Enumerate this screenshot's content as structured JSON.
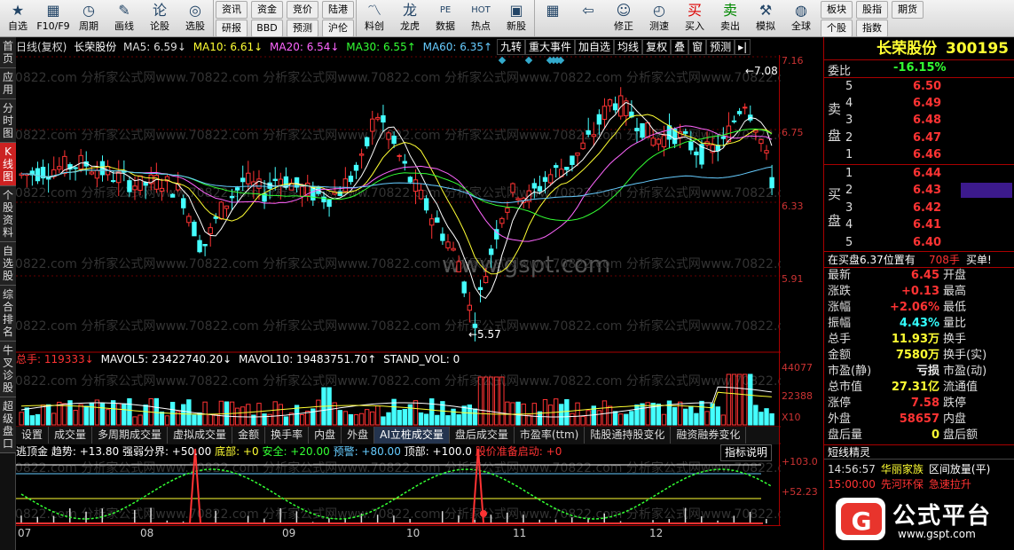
{
  "toolbar": {
    "items": [
      {
        "label": "自选",
        "icon": "star-icon"
      },
      {
        "label": "F10/F9",
        "icon": "f10-icon"
      },
      {
        "label": "周期",
        "icon": "clock-icon"
      },
      {
        "label": "画线",
        "icon": "pen-icon"
      },
      {
        "label": "论股",
        "icon": "chat-icon"
      },
      {
        "label": "选股",
        "icon": "stock-select-icon"
      }
    ],
    "pairs": [
      [
        "资讯",
        "研报"
      ],
      [
        "资金",
        "BBD"
      ],
      [
        "竞价",
        "预测"
      ],
      [
        "陆港",
        "沪伦"
      ]
    ],
    "items2": [
      {
        "label": "料创",
        "icon": "chart-icon"
      },
      {
        "label": "龙虎",
        "icon": "dragon-icon"
      },
      {
        "label": "数据",
        "icon": "data-icon"
      },
      {
        "label": "热点",
        "icon": "hot-icon"
      },
      {
        "label": "新股",
        "icon": "newstock-icon"
      }
    ],
    "items3": [
      {
        "label": "",
        "icon": "grid-icon"
      },
      {
        "label": "",
        "icon": "back-arrow-icon"
      },
      {
        "label": "修正",
        "icon": "fix-icon"
      },
      {
        "label": "测速",
        "icon": "speed-icon"
      },
      {
        "label": "买入",
        "icon": "buy-icon",
        "glyph": "买"
      },
      {
        "label": "卖出",
        "icon": "sell-icon",
        "glyph": "卖"
      },
      {
        "label": "模拟",
        "icon": "hammer-icon"
      },
      {
        "label": "全球",
        "icon": "globe-icon"
      }
    ],
    "pairs2": [
      [
        "板块",
        "个股"
      ],
      [
        "股指",
        "指数"
      ],
      [
        "期货",
        ""
      ]
    ]
  },
  "left_tabs": [
    "首页",
    "应用",
    "分时图",
    "K线图",
    "个股资料",
    "自选股",
    "综合排名",
    "牛叉诊股",
    "超级盘口"
  ],
  "active_tab": "K线图",
  "header": {
    "period": "日线(复权)",
    "stock": "长荣股份",
    "ma5": "MA5: 6.59↓",
    "ma10": "MA10: 6.61↓",
    "ma20": "MA20: 6.54↓",
    "ma30": "MA30: 6.55↑",
    "ma60": "MA60: 6.35↑"
  },
  "chart_buttons": [
    "九转",
    "重大事件",
    "加自选",
    "均线",
    "复权",
    "叠",
    "窗",
    "预测"
  ],
  "price_axis": [
    "7.16",
    "6.75",
    "6.33",
    "5.91"
  ],
  "price_annotations": {
    "high": "7.08",
    "low": "5.57"
  },
  "watermark": "www.gspt.com",
  "watermark2": "70822.com 分析家公式网www.70822.com 分析家公式网www.70822.com 分析家公式网www.70822.com 分析家公式网www.70822.com 分析家公式网",
  "volume_header": {
    "title": "总手: 119333↓",
    "mavol5": "MAVOL5: 23422740.20↓",
    "mavol10": "MAVOL10: 19483751.70↑",
    "stand": "STAND_VOL: 0"
  },
  "volume_axis": [
    "44077",
    "22388",
    "X10"
  ],
  "bottom_tabs": [
    "设置",
    "成交量",
    "多周期成交量",
    "虚拟成交量",
    "金额",
    "换手率",
    "内盘",
    "外盘",
    "AI立桩成交量",
    "盘后成交量",
    "市盈率(ttm)",
    "陆股通持股变化",
    "融资融券变化"
  ],
  "bottom_tab_active": "AI立桩成交量",
  "indicator2": {
    "name": "逃顶金",
    "trend": "趋势: +13.80",
    "strong": "强弱分界: +50.00",
    "bottom": "底部: +0",
    "safe": "安全: +20.00",
    "warn": "预警: +80.00",
    "top": "顶部: +100.0",
    "start": "股价准备启动: +0",
    "help": "指标说明"
  },
  "indicator2_axis": [
    "+103.0",
    "+52.23"
  ],
  "x_labels": [
    "07",
    "08",
    "09",
    "10",
    "11",
    "12"
  ],
  "panel": {
    "name": "长荣股份",
    "code": "300195",
    "weibi_label": "委比",
    "weibi": "-16.15%",
    "sell_label": "卖盘",
    "buy_label": "买盘",
    "sell": [
      {
        "n": "5",
        "p": "6.50"
      },
      {
        "n": "4",
        "p": "6.49"
      },
      {
        "n": "3",
        "p": "6.48"
      },
      {
        "n": "2",
        "p": "6.47"
      },
      {
        "n": "1",
        "p": "6.46"
      }
    ],
    "buy": [
      {
        "n": "1",
        "p": "6.44"
      },
      {
        "n": "2",
        "p": "6.43"
      },
      {
        "n": "3",
        "p": "6.42"
      },
      {
        "n": "4",
        "p": "6.41"
      },
      {
        "n": "5",
        "p": "6.40"
      }
    ],
    "note": "在买盘6.37位置有",
    "note_vol": "708手",
    "note_tag": "买单!",
    "quotes": [
      {
        "k1": "最新",
        "v1": "6.45",
        "c1": "red",
        "k2": "开盘",
        "v2": ""
      },
      {
        "k1": "涨跌",
        "v1": "+0.13",
        "c1": "red",
        "k2": "最高",
        "v2": ""
      },
      {
        "k1": "涨幅",
        "v1": "+2.06%",
        "c1": "red",
        "k2": "最低",
        "v2": ""
      },
      {
        "k1": "振幅",
        "v1": "4.43%",
        "c1": "cyn",
        "k2": "量比",
        "v2": ""
      },
      {
        "k1": "总手",
        "v1": "11.93万",
        "c1": "yel",
        "k2": "换手",
        "v2": ""
      },
      {
        "k1": "金额",
        "v1": "7580万",
        "c1": "yel",
        "k2": "换手(实)",
        "v2": ""
      },
      {
        "k1": "市盈(静)",
        "v1": "亏损",
        "c1": "wht",
        "k2": "市盈(动)",
        "v2": ""
      },
      {
        "k1": "总市值",
        "v1": "27.31亿",
        "c1": "yel",
        "k2": "流通值",
        "v2": ""
      },
      {
        "k1": "涨停",
        "v1": "7.58",
        "c1": "red",
        "k2": "跌停",
        "v2": ""
      },
      {
        "k1": "外盘",
        "v1": "58657",
        "c1": "red",
        "k2": "内盘",
        "v2": ""
      },
      {
        "k1": "盘后量",
        "v1": "0",
        "c1": "yel",
        "k2": "盘后额",
        "v2": ""
      }
    ],
    "elf_title": "短线精灵",
    "elf": [
      {
        "t": "14:56:57",
        "n": "华丽家族",
        "e": "区间放量(平)"
      },
      {
        "t": "15:00:00",
        "n": "先河环保",
        "e": "急速拉升"
      }
    ]
  },
  "logo": {
    "text": "公式平台",
    "url": "www.gspt.com",
    "colors": {
      "red": "#e8342c"
    }
  }
}
